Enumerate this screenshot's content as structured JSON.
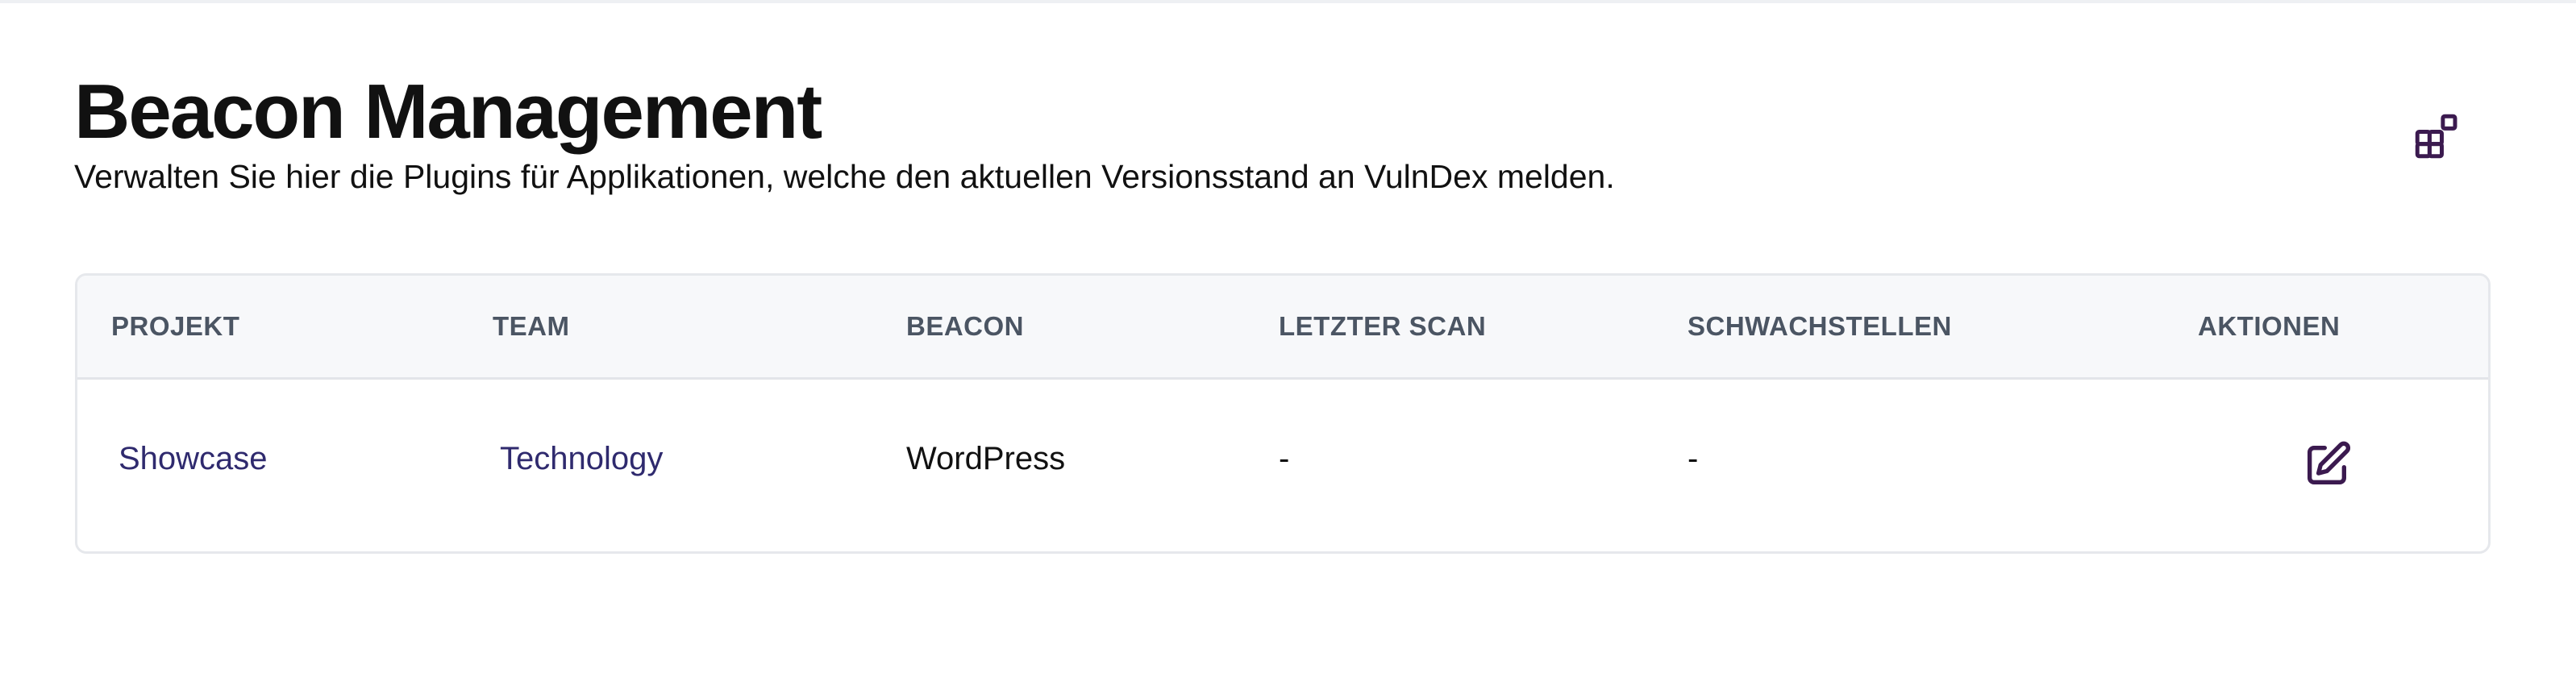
{
  "header": {
    "title": "Beacon Management",
    "subtitle": "Verwalten Sie hier die Plugins für Applikationen, welche den aktuellen Versionsstand an VulnDex melden."
  },
  "corner_action": {
    "icon": "widgets-add-icon"
  },
  "table": {
    "columns": [
      "PROJEKT",
      "TEAM",
      "BEACON",
      "LETZTER SCAN",
      "SCHWACHSTELLEN",
      "AKTIONEN"
    ],
    "rows": [
      {
        "project": "Showcase",
        "team": "Technology",
        "beacon": "WordPress",
        "last_scan": "-",
        "vulnerabilities": "-",
        "action_icon": "edit-icon"
      }
    ]
  },
  "colors": {
    "accent": "#3b1a4f",
    "link": "#2f2a6e",
    "header_bg": "#f7f8fa",
    "header_text": "#4b5563"
  }
}
